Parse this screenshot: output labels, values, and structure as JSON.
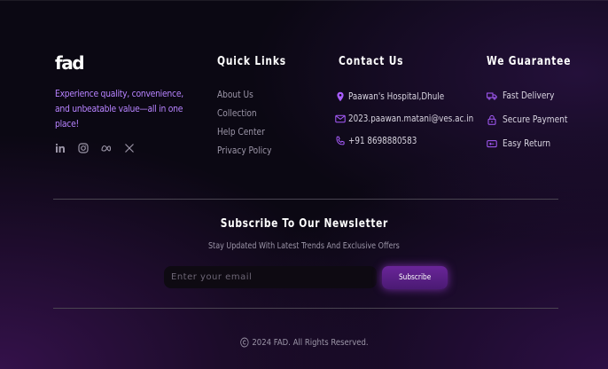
{
  "brand": {
    "logo_text": "fad",
    "tagline": "Experience quality, convenience, and unbeatable value—all in one place!",
    "socials": [
      {
        "name": "linkedin-icon"
      },
      {
        "name": "instagram-icon"
      },
      {
        "name": "meta-icon"
      },
      {
        "name": "x-icon"
      }
    ]
  },
  "quick_links": {
    "heading": "Quick Links",
    "items": [
      "About Us",
      "Collection",
      "Help Center",
      "Privacy Policy"
    ]
  },
  "contact": {
    "heading": "Contact Us",
    "address": "Paawan's Hospital,Dhule",
    "email": "2023.paawan.matani@ves.ac.in",
    "phone": "+91 8698880583"
  },
  "guarantee": {
    "heading": "We Guarantee",
    "items": [
      "Fast Delivery",
      "Secure Payment",
      "Easy Return"
    ]
  },
  "newsletter": {
    "title": "Subscribe To Our Newsletter",
    "subtitle": "Stay Updated With Latest Trends And Exclusive Offers",
    "email_placeholder": "Enter your email",
    "button_label": "Subscribe"
  },
  "footer": {
    "copyright": "2024 FAD. All Rights Reserved."
  },
  "colors": {
    "accent": "#b783ff",
    "button": "#5a1f86",
    "background": "#0b0813"
  }
}
